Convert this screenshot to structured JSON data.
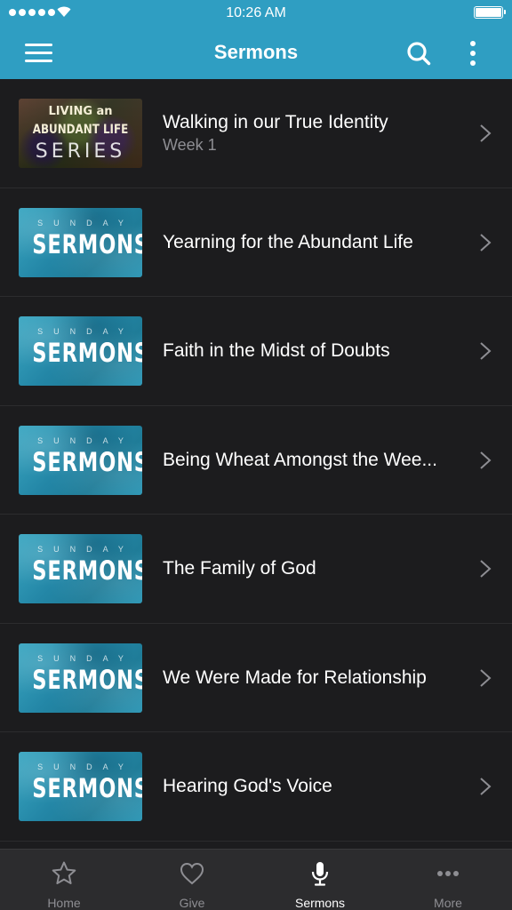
{
  "status_bar": {
    "time": "10:26 AM"
  },
  "header": {
    "title": "Sermons"
  },
  "thumbnails": {
    "series": {
      "line1": "LIVING an",
      "line2": "ABUNDANT LIFE",
      "line3": "SERIES"
    },
    "sunday": {
      "small": "SUNDAY",
      "big": "SERMONS"
    }
  },
  "sermons": [
    {
      "title": "Walking in our True Identity",
      "subtitle": "Week 1",
      "thumbnail": "series"
    },
    {
      "title": "Yearning for the Abundant Life",
      "subtitle": "",
      "thumbnail": "sunday"
    },
    {
      "title": "Faith in the Midst of Doubts",
      "subtitle": "",
      "thumbnail": "sunday"
    },
    {
      "title": "Being Wheat Amongst the Wee...",
      "subtitle": "",
      "thumbnail": "sunday"
    },
    {
      "title": "The Family of God",
      "subtitle": "",
      "thumbnail": "sunday"
    },
    {
      "title": "We Were Made for Relationship",
      "subtitle": "",
      "thumbnail": "sunday"
    },
    {
      "title": "Hearing God's Voice",
      "subtitle": "",
      "thumbnail": "sunday"
    },
    {
      "title": "",
      "subtitle": "",
      "thumbnail": "sunday"
    }
  ],
  "tab_bar": {
    "tabs": [
      {
        "label": "Home",
        "icon": "star-icon",
        "active": false
      },
      {
        "label": "Give",
        "icon": "heart-icon",
        "active": false
      },
      {
        "label": "Sermons",
        "icon": "microphone-icon",
        "active": true
      },
      {
        "label": "More",
        "icon": "ellipsis-icon",
        "active": false
      }
    ]
  },
  "colors": {
    "accent": "#2f9ec2",
    "background": "#1c1c1e",
    "tab_bar": "#2c2c2e"
  }
}
